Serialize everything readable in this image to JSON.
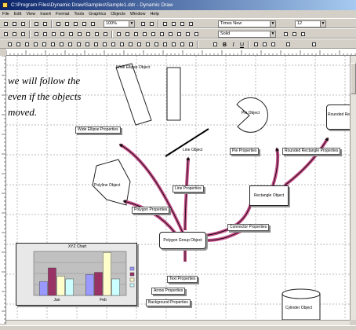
{
  "window": {
    "title": "C:\\Program Files\\Dynamic Draw\\Samples\\Sample1.ddr - Dynamic Draw"
  },
  "menu": [
    "File",
    "Edit",
    "View",
    "Insert",
    "Format",
    "Tools",
    "Graphics",
    "Objects",
    "Window",
    "Help"
  ],
  "toolbar": {
    "zoom_value": "100%",
    "font_name": "Times New",
    "font_size": "12",
    "line_style": "Solid"
  },
  "canvas": {
    "caption_lines": [
      "we will follow the",
      "even if the objects",
      "moved."
    ],
    "labels": {
      "wide_thin_top": "Wide Ellipse Object",
      "wide_props": "Wide Ellipse Properties",
      "polygon_object": "Polyline Object",
      "line_object": "Line Object",
      "line_props": "Line Properties",
      "polygon_props": "Polygon Properties",
      "polygon_group": "Polygon Group Object",
      "text_props": "Text Properties",
      "arrow_props": "Arrow Properties",
      "background_props": "Background Properties",
      "pie_object": "Pie Object",
      "pie_props": "Pie Properties",
      "rect_object": "Rectangle Object",
      "rect_props": "Rectangle Properties",
      "rect_group": "Rounded Rectangle Properties",
      "rounded_object": "Rounded Rect Object",
      "connector_props": "Connector Properties",
      "cylinder_object": "Cylinder Object"
    }
  },
  "chart_data": {
    "type": "bar",
    "title": "XYZ Chart",
    "categories": [
      "Jan",
      "Feb"
    ],
    "series": [
      {
        "color": "#9999ff",
        "values": [
          25,
          38
        ]
      },
      {
        "color": "#993366",
        "values": [
          50,
          42
        ]
      },
      {
        "color": "#ffffcc",
        "values": [
          35,
          78
        ]
      },
      {
        "color": "#ccffff",
        "values": [
          30,
          30
        ]
      }
    ],
    "ylim": [
      0,
      80
    ],
    "grid": true
  }
}
